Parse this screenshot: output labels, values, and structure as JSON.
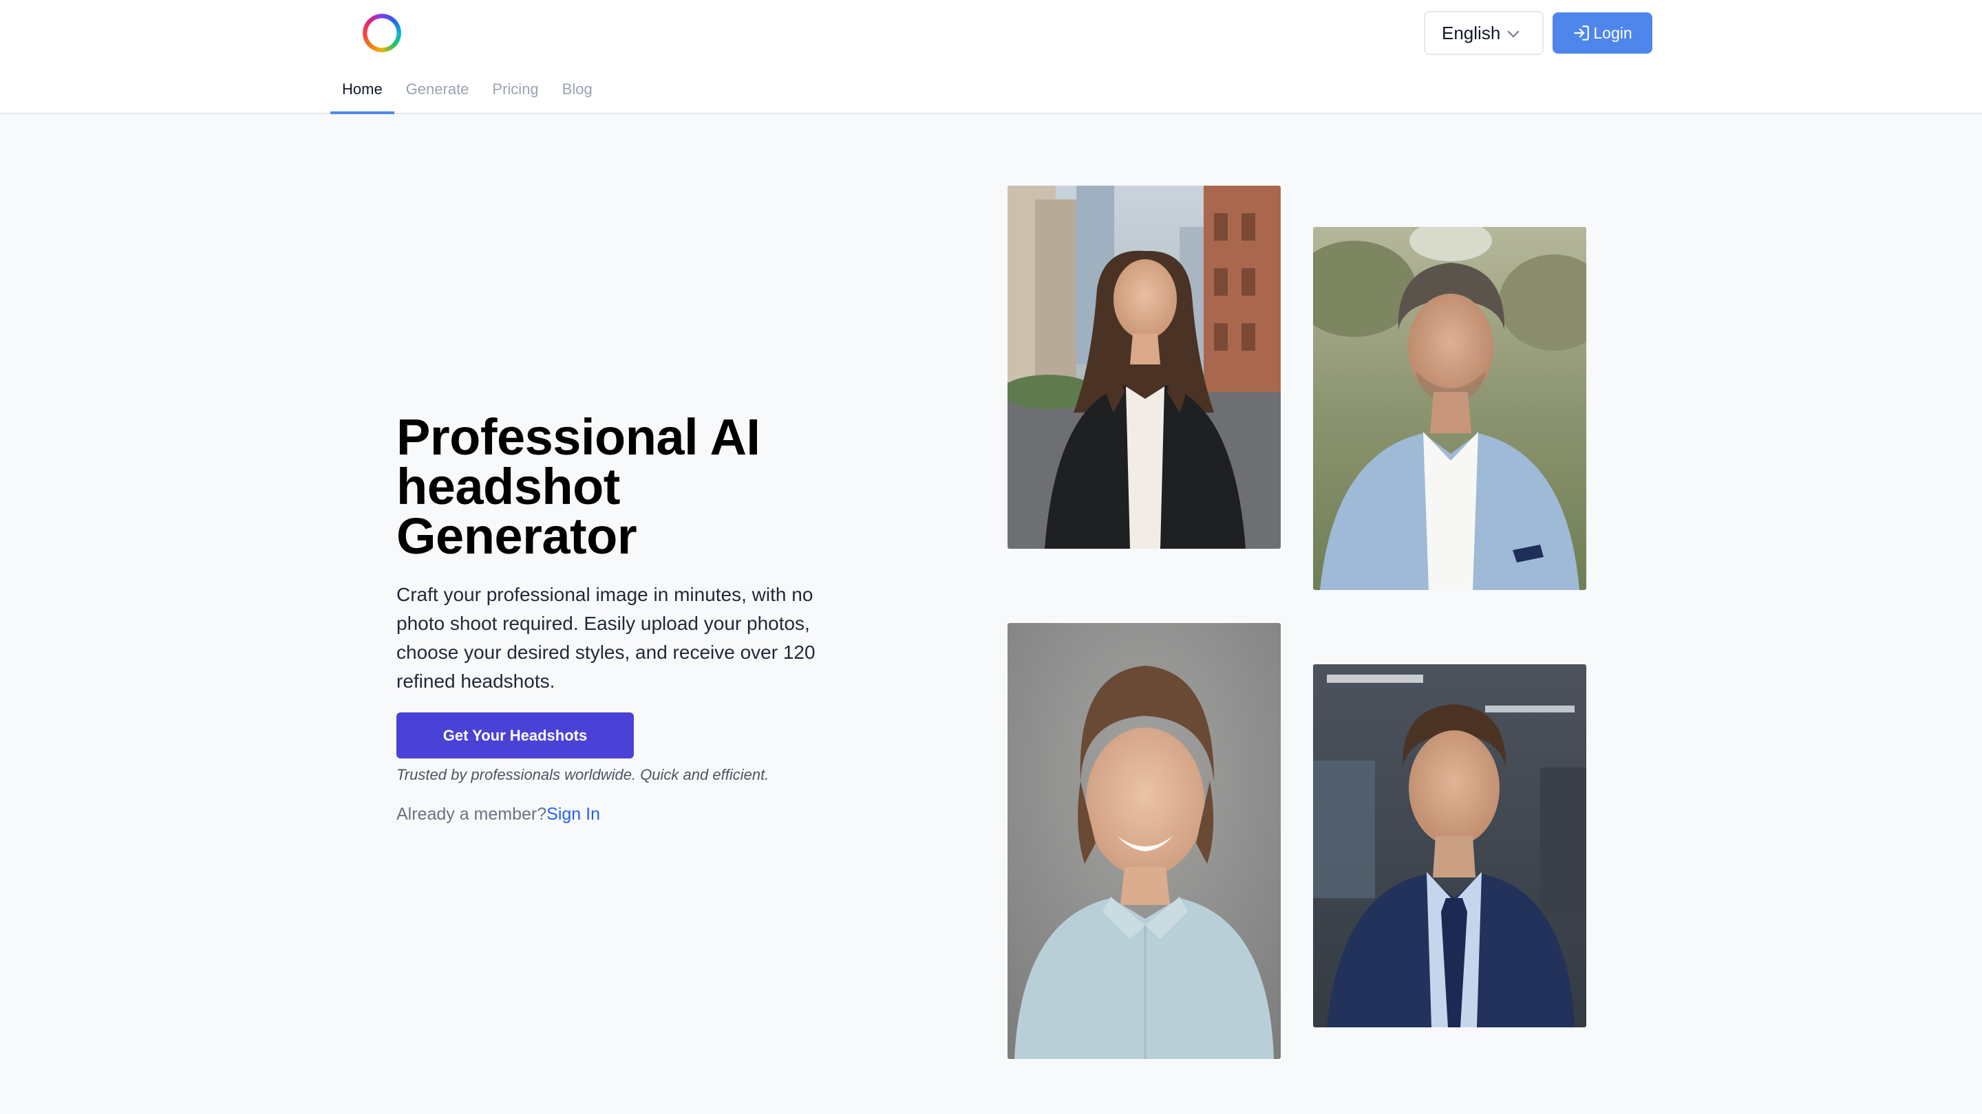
{
  "header": {
    "logo_icon": "rainbow-ring-logo-icon",
    "language": {
      "selected": "English",
      "icon": "chevron-down-icon"
    },
    "login": {
      "label": "Login",
      "icon": "login-arrow-icon",
      "color": "#4f86ec"
    }
  },
  "nav": {
    "items": [
      {
        "label": "Home",
        "active": true
      },
      {
        "label": "Generate",
        "active": false
      },
      {
        "label": "Pricing",
        "active": false
      },
      {
        "label": "Blog",
        "active": false
      }
    ],
    "active_color": "#4f86ec"
  },
  "hero": {
    "title": "Professional AI headshot Generator",
    "description": "Craft your professional image in minutes, with no photo shoot required. Easily upload your photos, choose your desired styles, and receive over 120 refined headshots.",
    "cta_label": "Get Your Headshots",
    "cta_color": "#4a42d6",
    "trusted_text": "Trusted by professionals worldwide. Quick and efficient.",
    "member_text": "Already a member?",
    "signin_label": "Sign In",
    "signin_color": "#2563eb"
  },
  "gallery": {
    "photos": [
      {
        "subject": "woman-black-blazer-city-street"
      },
      {
        "subject": "man-light-blue-suit-park"
      },
      {
        "subject": "woman-light-blue-shirt-gray-backdrop"
      },
      {
        "subject": "man-navy-suit-office"
      }
    ]
  }
}
